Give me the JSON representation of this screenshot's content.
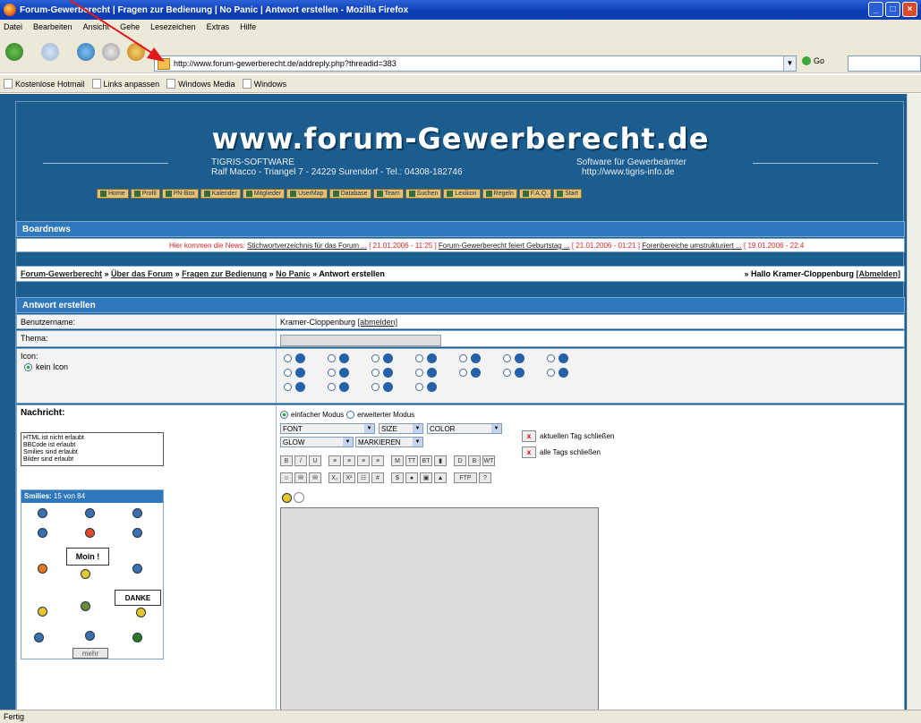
{
  "window": {
    "title": "Forum-Gewerberecht | Fragen zur Bedienung | No Panic | Antwort erstellen - Mozilla Firefox"
  },
  "menu": [
    "Datei",
    "Bearbeiten",
    "Ansicht",
    "Gehe",
    "Lesezeichen",
    "Extras",
    "Hilfe"
  ],
  "address": {
    "url": "http://www.forum-gewerberecht.de/addreply.php?threadid=383",
    "go_label": "Go"
  },
  "bookmarks": [
    "Kostenlose Hotmail",
    "Links anpassen",
    "Windows Media",
    "Windows"
  ],
  "site": {
    "title": "www.forum-Gewerberecht.de",
    "left_line1": "TIGRIS-SOFTWARE",
    "left_line2": "Ralf Macco - Triangel 7 - 24229 Surendorf - Tel.: 04308-182746",
    "right_line1": "Software für Gewerbeämter",
    "right_line2": "http://www.tigris-info.de",
    "nav": [
      "Home",
      "Profil",
      "PN-Box",
      "Kalender",
      "Mitglieder",
      "UserMap",
      "Database",
      "Team",
      "Suchen",
      "Lexikon",
      "Regeln",
      "F.A.Q.",
      "Start"
    ]
  },
  "boardnews": {
    "header": "Boardnews",
    "lead": "Hier kommen die News:",
    "items": [
      {
        "title": "Stichwortverzeichnis für das Forum ...",
        "date": "[ 21.01.2006 - 11:25 ]"
      },
      {
        "title": "Forum-Gewerberecht feiert Geburtstag ...",
        "date": "[ 21.01.2006 - 01:21 ]"
      },
      {
        "title": "Forenbereiche umstrukturiert ...",
        "date": "[ 19.01.2006 - 22:4"
      }
    ]
  },
  "breadcrumb": {
    "items": [
      "Forum-Gewerberecht",
      "Über das Forum",
      "Fragen zur Bedienung",
      "No Panic"
    ],
    "current": "Antwort erstellen",
    "greeting": "» Hallo Kramer-Cloppenburg",
    "logout": "[Abmelden]"
  },
  "form": {
    "header": "Antwort erstellen",
    "username_label": "Benutzername:",
    "username_value": "Kramer-Cloppenburg",
    "username_logout": "[abmelden]",
    "thema_label": "Thema:",
    "icon_label": "Icon:",
    "no_icon": "kein Icon",
    "message_label": "Nachricht:",
    "rules": [
      "HTML ist nicht erlaubt",
      "BBCode ist erlaubt",
      "Smilies sind erlaubt",
      "Bilder sind erlaubt"
    ],
    "smilies_header": "Smilies:",
    "smilies_count": "15 von 84",
    "smilie_moin": "Moin !",
    "smilie_danke": "DANKE",
    "more": "mehr",
    "mode_simple": "einfacher Modus",
    "mode_extended": "erweiterter Modus",
    "selects": {
      "font": "FONT",
      "size": "SIZE",
      "color": "COLOR",
      "glow": "GLOW",
      "mark": "MARKIEREN"
    },
    "close_current": "aktuellen Tag schließen",
    "close_all": "alle Tags schließen",
    "toolbar_row1": [
      "B",
      "/",
      "U",
      "≡",
      "≡",
      "≡",
      "≡",
      "M",
      "TT",
      "BT",
      "▮",
      "D",
      "B",
      "WT"
    ],
    "toolbar_row2": [
      "☺",
      "✉",
      "✉",
      "X₂",
      "X²",
      "☷",
      "#",
      "$",
      "●",
      "▣",
      "▲",
      "FTP",
      "?"
    ]
  },
  "status": "Fertig",
  "colors": {
    "page_bg": "#1c5d8f",
    "header_blue": "#2e78bb",
    "title_red": "#d8252b"
  }
}
